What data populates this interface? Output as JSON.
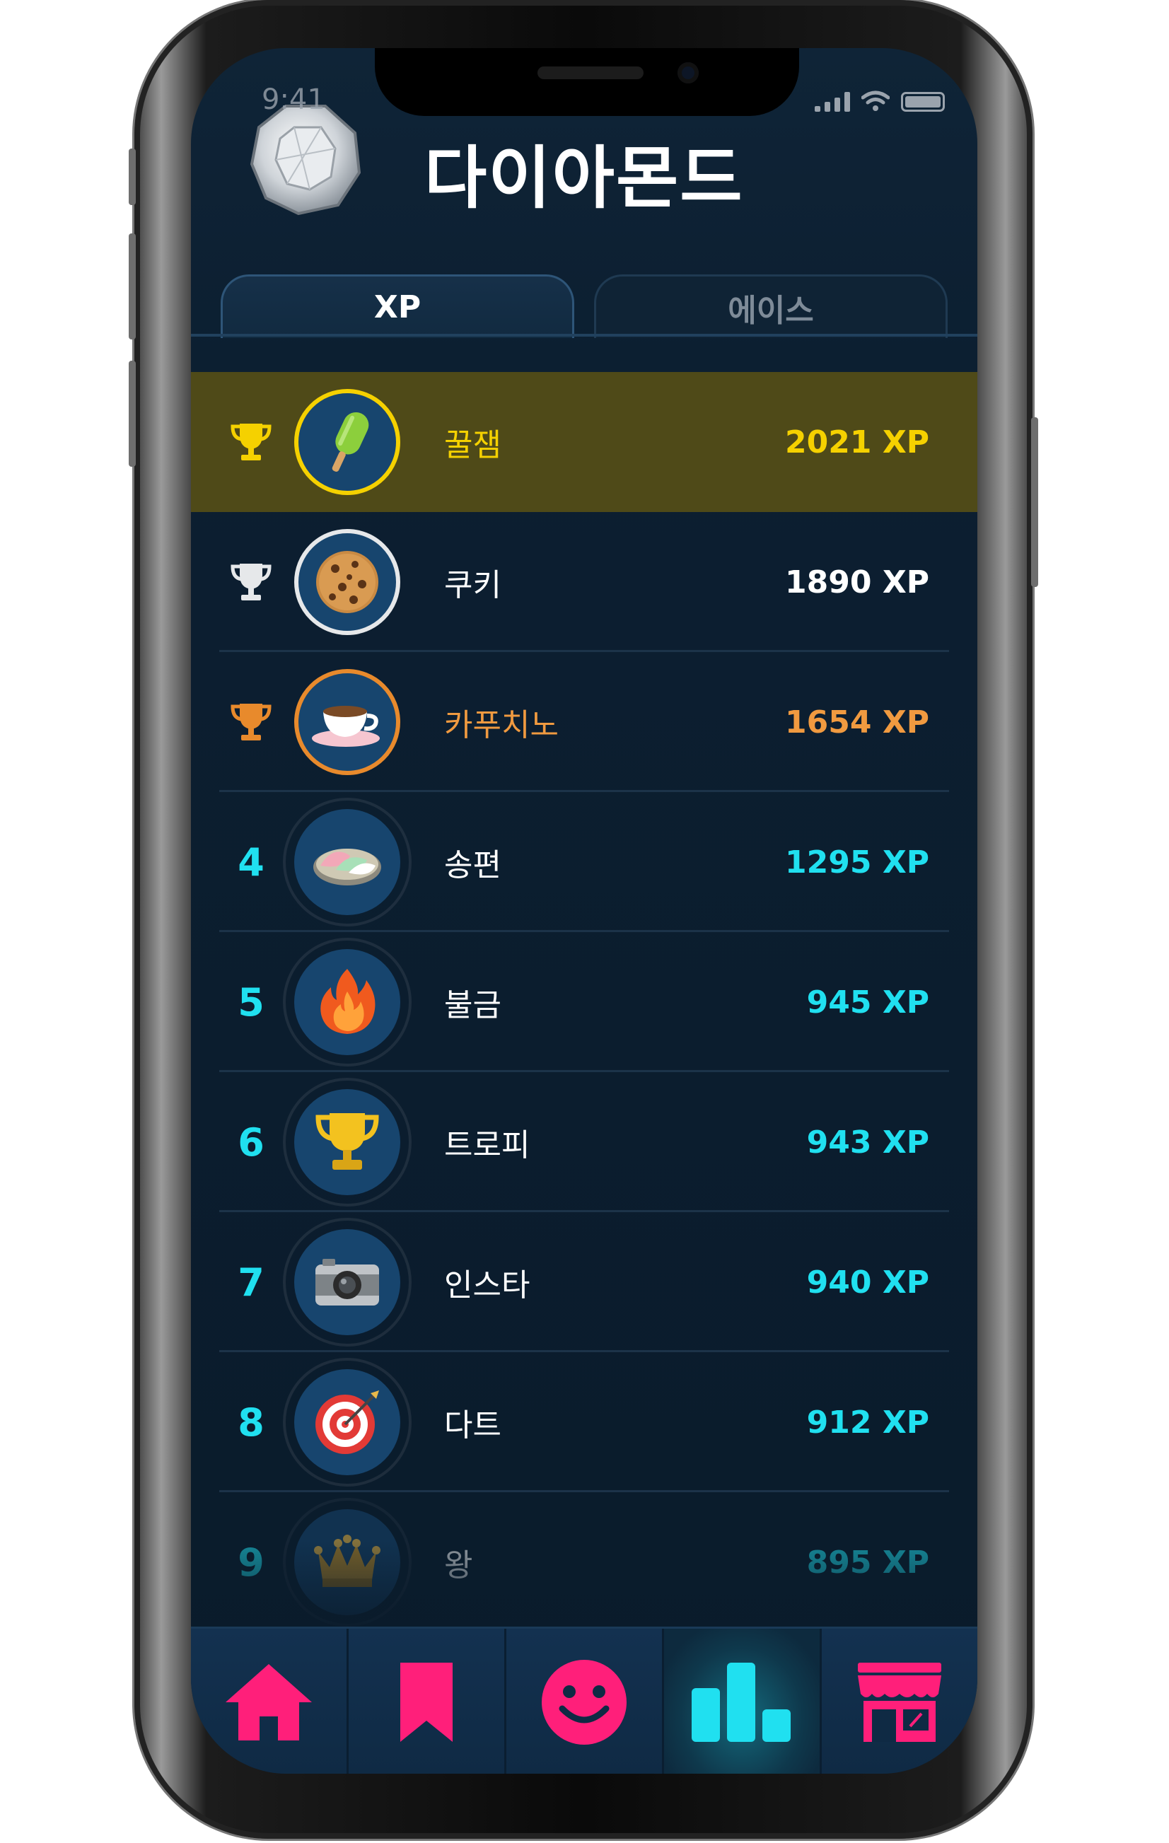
{
  "status_bar": {
    "time": "9:41"
  },
  "header": {
    "title": "다이아몬드",
    "badge_icon": "diamond-icon"
  },
  "tabs": [
    {
      "label": "XP",
      "active": true
    },
    {
      "label": "에이스",
      "active": false
    }
  ],
  "leaderboard": [
    {
      "rank": "",
      "medal": "gold",
      "name": "꿀잼",
      "xp": "2021 XP",
      "icon": "popsicle-icon"
    },
    {
      "rank": "",
      "medal": "silver",
      "name": "쿠키",
      "xp": "1890 XP",
      "icon": "cookie-icon"
    },
    {
      "rank": "",
      "medal": "bronze",
      "name": "카푸치노",
      "xp": "1654 XP",
      "icon": "coffee-cup-icon"
    },
    {
      "rank": "4",
      "name": "송편",
      "xp": "1295 XP",
      "icon": "songpyeon-icon"
    },
    {
      "rank": "5",
      "name": "불금",
      "xp": "945 XP",
      "icon": "fire-icon"
    },
    {
      "rank": "6",
      "name": "트로피",
      "xp": "943 XP",
      "icon": "trophy-icon"
    },
    {
      "rank": "7",
      "name": "인스타",
      "xp": "940 XP",
      "icon": "camera-icon"
    },
    {
      "rank": "8",
      "name": "다트",
      "xp": "912 XP",
      "icon": "dartboard-icon"
    },
    {
      "rank": "9",
      "name": "왕",
      "xp": "895 XP",
      "icon": "crown-icon"
    }
  ],
  "bottom_nav": [
    {
      "icon": "home-icon",
      "active": false
    },
    {
      "icon": "bookmark-icon",
      "active": false
    },
    {
      "icon": "smiley-icon",
      "active": false
    },
    {
      "icon": "leaderboard-icon",
      "active": true
    },
    {
      "icon": "store-icon",
      "active": false
    }
  ],
  "colors": {
    "gold": "#f5d100",
    "silver": "#e6e8ea",
    "bronze": "#f09a40",
    "rank_cyan": "#20e0f0",
    "nav_pink": "#ff1f7a",
    "first_row_bg": "#4f4a18",
    "screen_bg": "#0a1b2b"
  }
}
